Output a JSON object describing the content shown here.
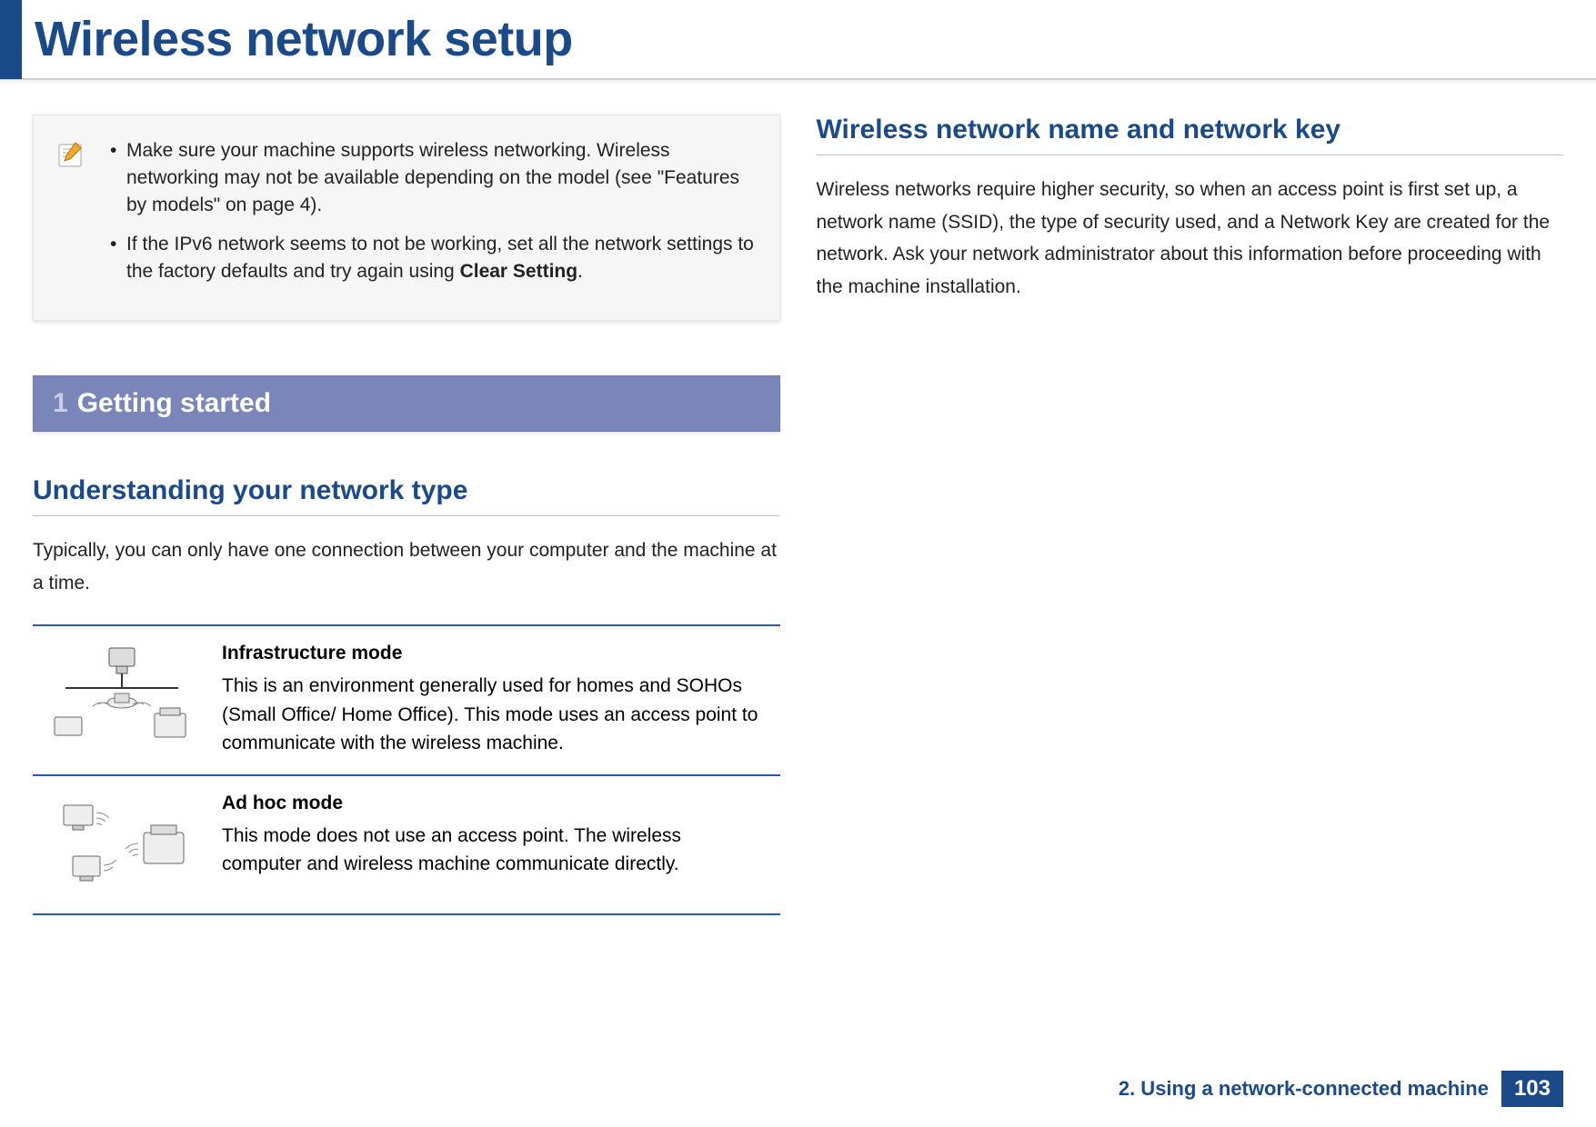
{
  "header": {
    "title": "Wireless network setup"
  },
  "left": {
    "note": {
      "bullet1_pre": "Make sure your machine supports wireless networking. Wireless networking may not be available depending on the model (see \"Features by models\" on page 4).",
      "bullet2_pre": "If the IPv6 network seems to not be working, set all the network settings to the factory defaults and try again using ",
      "bullet2_bold": "Clear Setting",
      "bullet2_post": "."
    },
    "section": {
      "num": "1",
      "label": "Getting started"
    },
    "sub1": {
      "heading": "Understanding your network type",
      "body": "Typically, you can only have one connection between your computer and the machine at a time."
    },
    "modes": [
      {
        "title": "Infrastructure mode",
        "desc": "This is an environment generally used for homes and SOHOs (Small Office/ Home Office). This mode uses an access point to communicate with the wireless machine."
      },
      {
        "title": "Ad hoc mode",
        "desc": "This mode does not use an access point. The wireless computer and wireless machine communicate directly."
      }
    ]
  },
  "right": {
    "sub2": {
      "heading": "Wireless network name and network key",
      "body": "Wireless networks require higher security, so when an access point is first set up, a network name (SSID), the type of security used, and a Network Key are created for the network. Ask your network administrator about this information before proceeding with the machine installation."
    }
  },
  "footer": {
    "chapter": "2. Using a network-connected machine",
    "page": "103"
  }
}
